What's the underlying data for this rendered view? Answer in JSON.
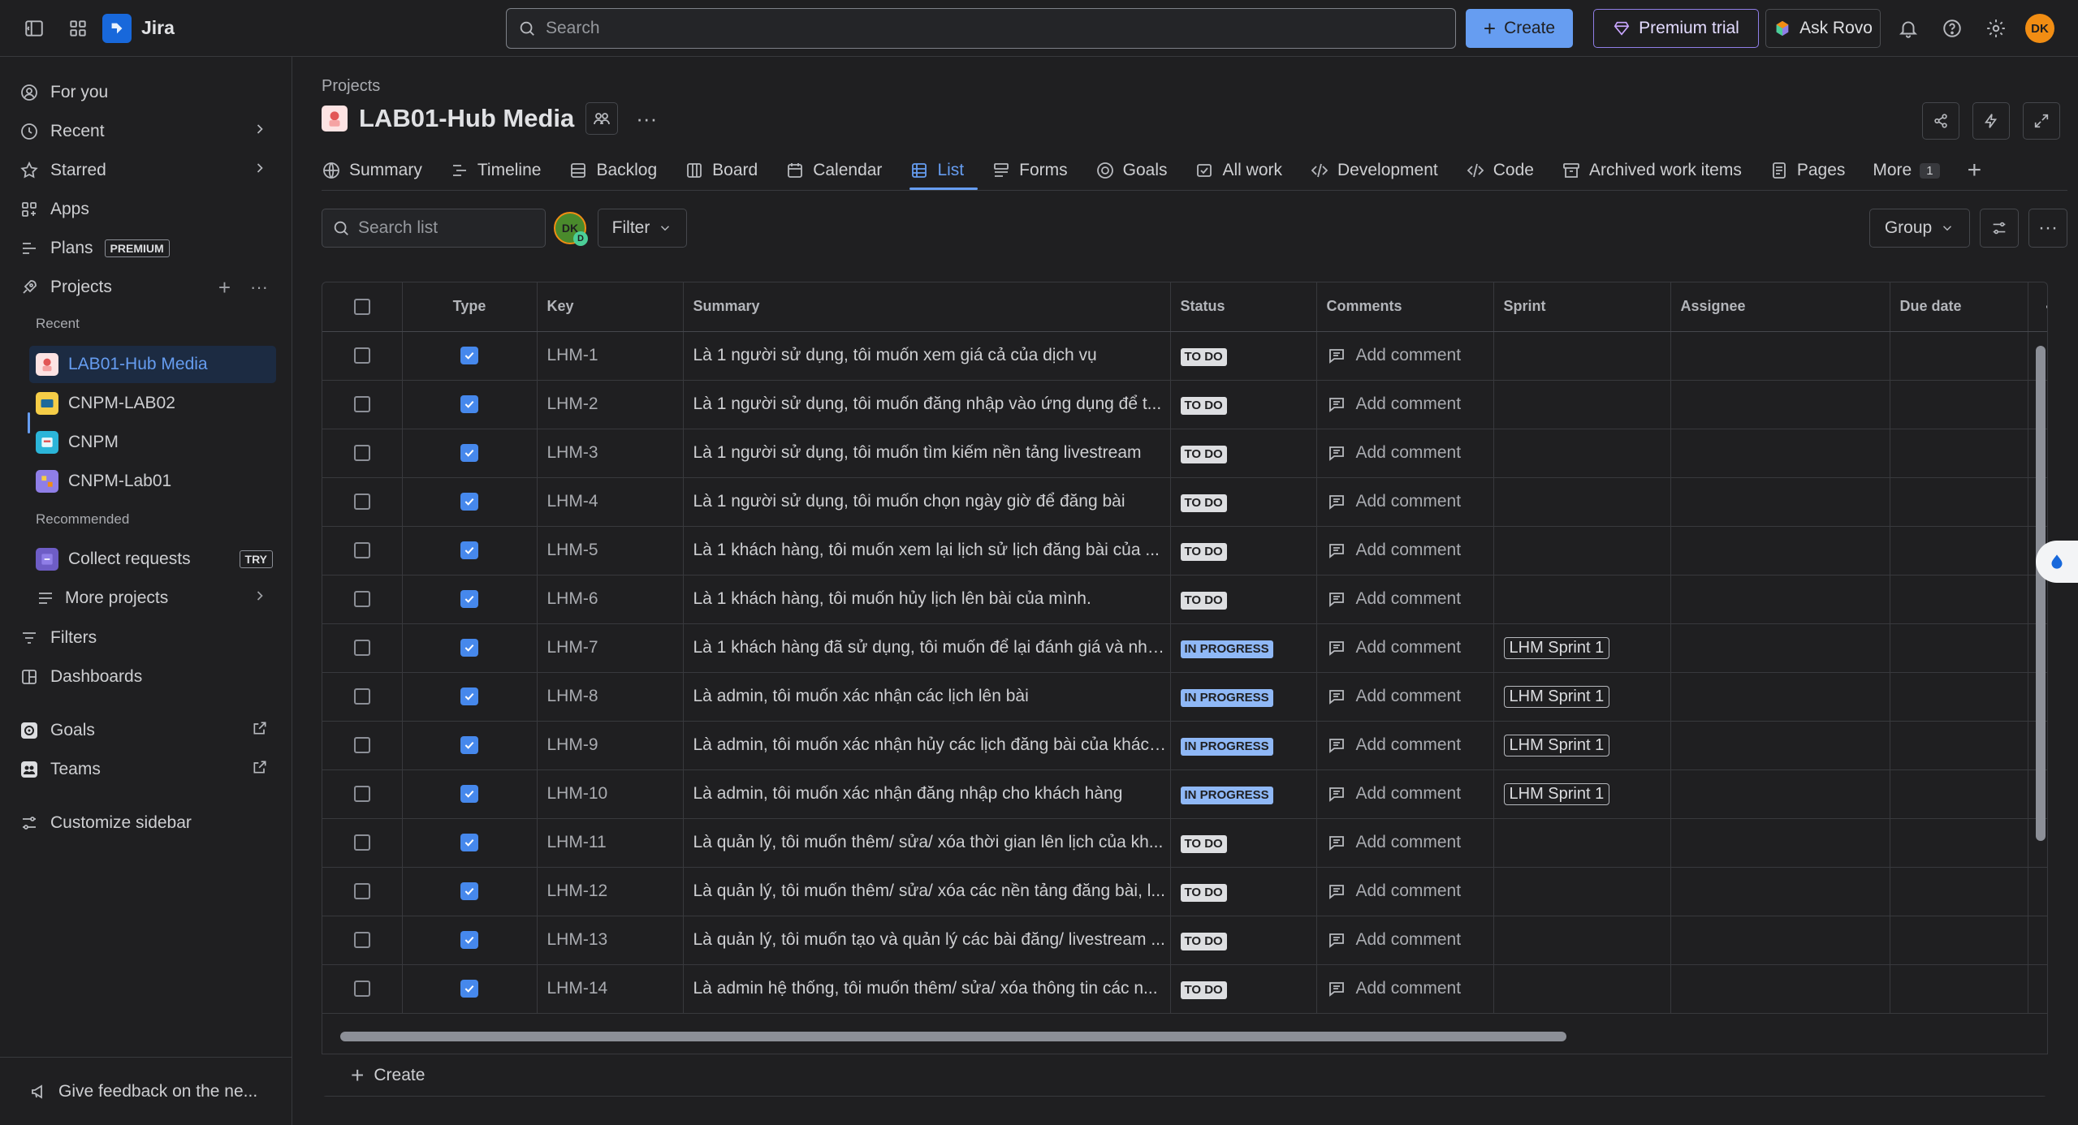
{
  "app": {
    "name": "Jira"
  },
  "topbar": {
    "search_placeholder": "Search",
    "create_label": "Create",
    "premium_label": "Premium trial",
    "rovo_label": "Ask Rovo",
    "avatar_initials": "DK"
  },
  "sidebar": {
    "for_you": "For you",
    "recent": "Recent",
    "starred": "Starred",
    "apps": "Apps",
    "plans": "Plans",
    "plans_badge": "PREMIUM",
    "projects": "Projects",
    "recent_label": "Recent",
    "recent_projects": [
      "LAB01-Hub Media",
      "CNPM-LAB02",
      "CNPM",
      "CNPM-Lab01"
    ],
    "recommended_label": "Recommended",
    "collect_requests": "Collect requests",
    "try_badge": "TRY",
    "more_projects": "More projects",
    "filters": "Filters",
    "dashboards": "Dashboards",
    "goals": "Goals",
    "teams": "Teams",
    "customize": "Customize sidebar",
    "feedback": "Give feedback on the ne..."
  },
  "header": {
    "breadcrumb": "Projects",
    "project_title": "LAB01-Hub Media"
  },
  "tabs": [
    {
      "label": "Summary",
      "icon": "globe-icon"
    },
    {
      "label": "Timeline",
      "icon": "timeline-icon"
    },
    {
      "label": "Backlog",
      "icon": "backlog-icon"
    },
    {
      "label": "Board",
      "icon": "board-icon"
    },
    {
      "label": "Calendar",
      "icon": "calendar-icon"
    },
    {
      "label": "List",
      "icon": "list-icon"
    },
    {
      "label": "Forms",
      "icon": "forms-icon"
    },
    {
      "label": "Goals",
      "icon": "goals-icon"
    },
    {
      "label": "All work",
      "icon": "all-work-icon"
    },
    {
      "label": "Development",
      "icon": "development-icon"
    },
    {
      "label": "Code",
      "icon": "code-icon"
    },
    {
      "label": "Archived work items",
      "icon": "archive-icon"
    },
    {
      "label": "Pages",
      "icon": "pages-icon"
    }
  ],
  "more_tab": {
    "label": "More",
    "count": "1"
  },
  "toolbar": {
    "search_placeholder": "Search list",
    "filter_avatar": "DK",
    "filter_avatar_sub": "D",
    "filter_label": "Filter",
    "group_label": "Group"
  },
  "table": {
    "columns": [
      "Type",
      "Key",
      "Summary",
      "Status",
      "Comments",
      "Sprint",
      "Assignee",
      "Due date"
    ],
    "add_comment": "Add comment",
    "rows": [
      {
        "key": "LHM-1",
        "summary": "Là 1 người sử dụng, tôi muốn xem giá cả của dịch vụ",
        "status": "TO DO",
        "sprint": ""
      },
      {
        "key": "LHM-2",
        "summary": "Là 1 người sử dụng, tôi muốn đăng nhập vào ứng dụng để t...",
        "status": "TO DO",
        "sprint": ""
      },
      {
        "key": "LHM-3",
        "summary": "Là 1 người sử dụng, tôi muốn tìm kiếm nền tảng livestream",
        "status": "TO DO",
        "sprint": ""
      },
      {
        "key": "LHM-4",
        "summary": "Là 1 người sử dụng, tôi muốn chọn ngày giờ để đăng bài",
        "status": "TO DO",
        "sprint": ""
      },
      {
        "key": "LHM-5",
        "summary": "Là 1 khách hàng, tôi muốn xem lại lịch sử lịch đăng bài của ...",
        "status": "TO DO",
        "sprint": ""
      },
      {
        "key": "LHM-6",
        "summary": "Là 1 khách hàng, tôi muốn hủy lịch lên bài của mình.",
        "status": "TO DO",
        "sprint": ""
      },
      {
        "key": "LHM-7",
        "summary": "Là 1 khách hàng đã sử dụng, tôi muốn để lại đánh giá và nhậ...",
        "status": "IN PROGRESS",
        "sprint": "LHM Sprint 1"
      },
      {
        "key": "LHM-8",
        "summary": "Là admin, tôi muốn xác nhận các lịch lên bài",
        "status": "IN PROGRESS",
        "sprint": "LHM Sprint 1"
      },
      {
        "key": "LHM-9",
        "summary": "Là admin, tôi muốn xác nhận hủy các lịch đăng bài của khách...",
        "status": "IN PROGRESS",
        "sprint": "LHM Sprint 1"
      },
      {
        "key": "LHM-10",
        "summary": "Là admin, tôi muốn xác nhận đăng nhập cho khách hàng",
        "status": "IN PROGRESS",
        "sprint": "LHM Sprint 1"
      },
      {
        "key": "LHM-11",
        "summary": "Là quản lý, tôi muốn thêm/ sửa/ xóa thời gian lên lịch của kh...",
        "status": "TO DO",
        "sprint": ""
      },
      {
        "key": "LHM-12",
        "summary": "Là quản lý, tôi muốn thêm/ sửa/ xóa các nền tảng đăng bài, l...",
        "status": "TO DO",
        "sprint": ""
      },
      {
        "key": "LHM-13",
        "summary": "Là quản lý, tôi muốn tạo và quản lý các bài đăng/ livestream ...",
        "status": "TO DO",
        "sprint": ""
      },
      {
        "key": "LHM-14",
        "summary": "Là admin hệ thống, tôi muốn thêm/ sửa/ xóa thông tin các n...",
        "status": "TO DO",
        "sprint": ""
      }
    ]
  },
  "footer": {
    "create_label": "Create"
  },
  "colors": {
    "accent": "#669df1",
    "background": "#1f1f21",
    "todo": "#dddee1",
    "in_progress": "#8fb8f6"
  }
}
